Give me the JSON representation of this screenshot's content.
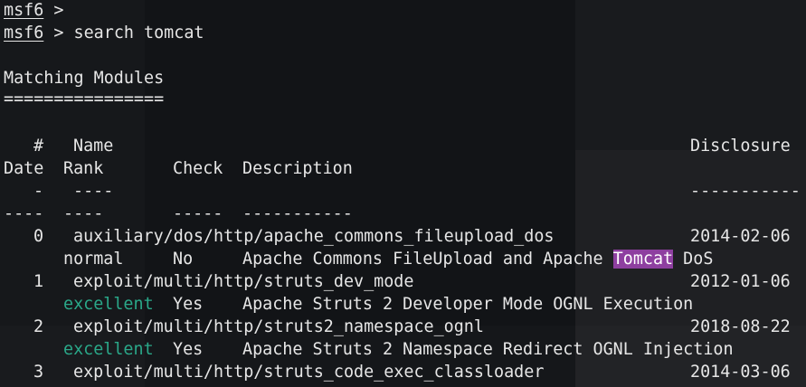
{
  "prompt": {
    "name": "msf6",
    "symbol": ">"
  },
  "command": "search tomcat",
  "heading": "Matching Modules",
  "heading_rule": "================",
  "table": {
    "header_line1": {
      "num": "#",
      "name": "Name",
      "disclosure": "Disclosure"
    },
    "header_line2": {
      "date": "Date",
      "rank": "Rank",
      "check": "Check",
      "description": "Description"
    },
    "rule_line1": {
      "num": "-",
      "name": "----",
      "disclosure": "-----------"
    },
    "rule_line2": {
      "date": "----",
      "rank": "----",
      "check": "-----",
      "description": "-----------"
    },
    "rows": [
      {
        "num": "0",
        "name": "auxiliary/dos/http/apache_commons_fileupload_dos",
        "date": "2014-02-06",
        "rank": "normal",
        "check": "No",
        "desc_before": "Apache Commons FileUpload and Apache ",
        "desc_highlight": "Tomcat",
        "desc_after": " DoS"
      },
      {
        "num": "1",
        "name": "exploit/multi/http/struts_dev_mode",
        "date": "2012-01-06",
        "rank": "excellent",
        "check": "Yes",
        "description": "Apache Struts 2 Developer Mode OGNL Execution"
      },
      {
        "num": "2",
        "name": "exploit/multi/http/struts2_namespace_ognl",
        "date": "2018-08-22",
        "rank": "excellent",
        "check": "Yes",
        "description": "Apache Struts 2 Namespace Redirect OGNL Injection"
      },
      {
        "num": "3",
        "name": "exploit/multi/http/struts_code_exec_classloader",
        "date": "2014-03-06"
      }
    ]
  },
  "colors": {
    "background": "#121417",
    "text": "#e6e6e6",
    "rank_excellent": "#2aa889",
    "search_highlight": "#8e3fa0"
  }
}
